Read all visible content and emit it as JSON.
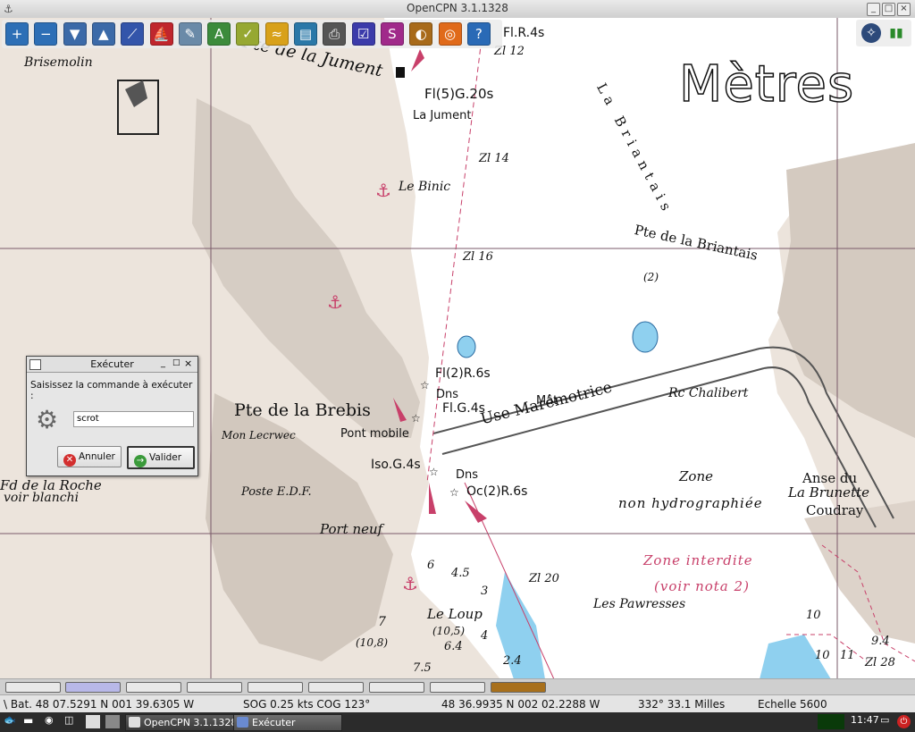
{
  "window": {
    "title": "OpenCPN 3.1.1328",
    "buttons": [
      "_",
      "□",
      "×"
    ]
  },
  "toolbar": {
    "items": [
      {
        "name": "zoom-in",
        "glyph": "+",
        "color": "#2d6fb6"
      },
      {
        "name": "zoom-out",
        "glyph": "−",
        "color": "#2d6fb6"
      },
      {
        "name": "scale-in",
        "glyph": "▼",
        "color": "#3b6aa8"
      },
      {
        "name": "scale-out",
        "glyph": "▲",
        "color": "#3b6aa8"
      },
      {
        "name": "route",
        "glyph": "⟋",
        "color": "#3355aa"
      },
      {
        "name": "auto-follow",
        "glyph": "⛵",
        "color": "#c0262d"
      },
      {
        "name": "settings",
        "glyph": "✎",
        "color": "#6a8aa8"
      },
      {
        "name": "text",
        "glyph": "A",
        "color": "#3c8b3c"
      },
      {
        "name": "current",
        "glyph": "✓",
        "color": "#96a832"
      },
      {
        "name": "tides",
        "glyph": "≈",
        "color": "#d8a11a"
      },
      {
        "name": "gpx",
        "glyph": "▤",
        "color": "#2a78a8"
      },
      {
        "name": "print",
        "glyph": "⎙",
        "color": "#555555"
      },
      {
        "name": "route-manager",
        "glyph": "☑",
        "color": "#3b3baa"
      },
      {
        "name": "track",
        "glyph": "S",
        "color": "#a02a8a"
      },
      {
        "name": "colour-scheme",
        "glyph": "◐",
        "color": "#a86a1a"
      },
      {
        "name": "mob",
        "glyph": "◎",
        "color": "#e06a1a"
      },
      {
        "name": "help",
        "glyph": "?",
        "color": "#2a6ab6"
      }
    ]
  },
  "watermark": "Mètres",
  "chart_labels": {
    "fl_r_4s": "Fl.R.4s",
    "zl12": "Zl 12",
    "pointe_jument": "Pte de la Jument",
    "brisemolin": "Brisemolin",
    "fl5g20s": "Fl(5)G.20s",
    "la_jument": "La Jument",
    "zl14": "Zl 14",
    "le_binic": "Le Binic",
    "zl16": "Zl 16",
    "la_briantais": "La Briantais",
    "pointe_briantais": "Pte de la Briantais",
    "two": "(2)",
    "fl2r6s": "Fl(2)R.6s",
    "dns1": "Dns",
    "mat": "Mât",
    "flg4s": "Fl.G.4s",
    "usine": "Use Marémotrice",
    "rchalibert": "Rc Chalibert",
    "pointe_brebis": "Pte de la Brebis",
    "mon_lecrwec": "Mon Lecrwec",
    "pont_mobile": "Pont mobile",
    "iso_g4s": "Iso.G.4s",
    "dns2": "Dns",
    "oc2r6s": "Oc(2)R.6s",
    "zone": "Zone",
    "non_hydro": "non hydrographiée",
    "anse": "Anse du",
    "brunette": "La Brunette",
    "coudray": "Coudray",
    "roche": "Fd de la Roche",
    "voir_blanchi": "voir blanchi",
    "poste_edf": "Poste E.D.F.",
    "port_neuf": "Port neuf",
    "zone_interdite": "Zone interdite",
    "voir_nota": "(voir nota 2)",
    "zl20": "Zl 20",
    "les_pawresses": "Les Pawresses",
    "le_loup": "Le Loup",
    "zl28": "Zl 28",
    "soundings": [
      "6",
      "4.5",
      "3",
      "7",
      "(10,8)",
      "(10,5)",
      "6.4",
      "4",
      "7.5",
      "2.4",
      "10",
      "11",
      "10",
      "9.4"
    ]
  },
  "dialog": {
    "title": "Exécuter",
    "prompt": "Saisissez la commande à exécuter :",
    "command": "scrot",
    "cancel": "Annuler",
    "ok": "Valider"
  },
  "status": {
    "bat": "\\ Bat. 48 07.5291 N   001 39.6305 W",
    "sog": "SOG 0.25 kts  COG 123°",
    "cursor": "48 36.9935 N   002 02.2288 W",
    "bearing": "332°  33.1 Milles",
    "scale": "Echelle 5600"
  },
  "taskbar": {
    "task1": "OpenCPN 3.1.1328",
    "task2": "Exécuter",
    "clock": "11:47"
  },
  "colors": {
    "land": "#ece4dc",
    "sea": "#ffffff",
    "shallow": "#8fd0ef",
    "magenta": "#c8406a"
  }
}
